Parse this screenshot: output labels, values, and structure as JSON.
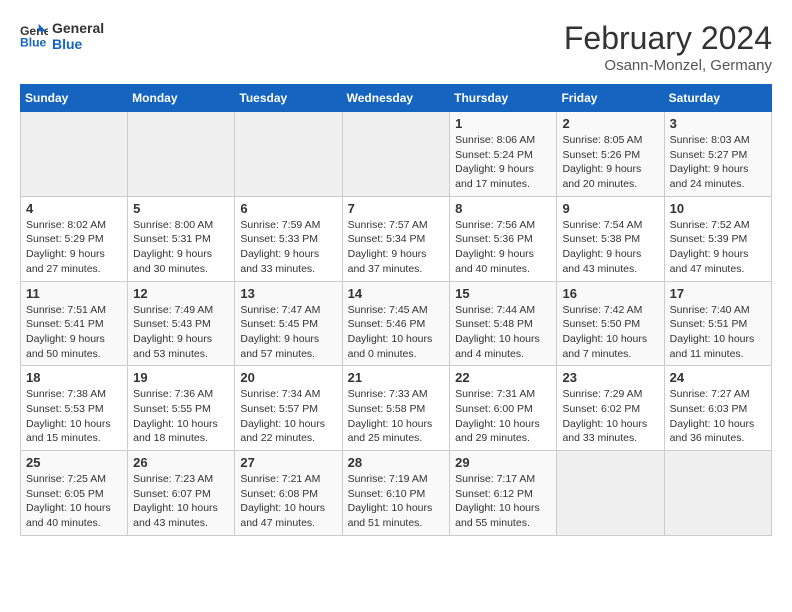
{
  "logo": {
    "text_general": "General",
    "text_blue": "Blue"
  },
  "header": {
    "month_year": "February 2024",
    "location": "Osann-Monzel, Germany"
  },
  "days_of_week": [
    "Sunday",
    "Monday",
    "Tuesday",
    "Wednesday",
    "Thursday",
    "Friday",
    "Saturday"
  ],
  "weeks": [
    [
      {
        "day": "",
        "info": ""
      },
      {
        "day": "",
        "info": ""
      },
      {
        "day": "",
        "info": ""
      },
      {
        "day": "",
        "info": ""
      },
      {
        "day": "1",
        "info": "Sunrise: 8:06 AM\nSunset: 5:24 PM\nDaylight: 9 hours\nand 17 minutes."
      },
      {
        "day": "2",
        "info": "Sunrise: 8:05 AM\nSunset: 5:26 PM\nDaylight: 9 hours\nand 20 minutes."
      },
      {
        "day": "3",
        "info": "Sunrise: 8:03 AM\nSunset: 5:27 PM\nDaylight: 9 hours\nand 24 minutes."
      }
    ],
    [
      {
        "day": "4",
        "info": "Sunrise: 8:02 AM\nSunset: 5:29 PM\nDaylight: 9 hours\nand 27 minutes."
      },
      {
        "day": "5",
        "info": "Sunrise: 8:00 AM\nSunset: 5:31 PM\nDaylight: 9 hours\nand 30 minutes."
      },
      {
        "day": "6",
        "info": "Sunrise: 7:59 AM\nSunset: 5:33 PM\nDaylight: 9 hours\nand 33 minutes."
      },
      {
        "day": "7",
        "info": "Sunrise: 7:57 AM\nSunset: 5:34 PM\nDaylight: 9 hours\nand 37 minutes."
      },
      {
        "day": "8",
        "info": "Sunrise: 7:56 AM\nSunset: 5:36 PM\nDaylight: 9 hours\nand 40 minutes."
      },
      {
        "day": "9",
        "info": "Sunrise: 7:54 AM\nSunset: 5:38 PM\nDaylight: 9 hours\nand 43 minutes."
      },
      {
        "day": "10",
        "info": "Sunrise: 7:52 AM\nSunset: 5:39 PM\nDaylight: 9 hours\nand 47 minutes."
      }
    ],
    [
      {
        "day": "11",
        "info": "Sunrise: 7:51 AM\nSunset: 5:41 PM\nDaylight: 9 hours\nand 50 minutes."
      },
      {
        "day": "12",
        "info": "Sunrise: 7:49 AM\nSunset: 5:43 PM\nDaylight: 9 hours\nand 53 minutes."
      },
      {
        "day": "13",
        "info": "Sunrise: 7:47 AM\nSunset: 5:45 PM\nDaylight: 9 hours\nand 57 minutes."
      },
      {
        "day": "14",
        "info": "Sunrise: 7:45 AM\nSunset: 5:46 PM\nDaylight: 10 hours\nand 0 minutes."
      },
      {
        "day": "15",
        "info": "Sunrise: 7:44 AM\nSunset: 5:48 PM\nDaylight: 10 hours\nand 4 minutes."
      },
      {
        "day": "16",
        "info": "Sunrise: 7:42 AM\nSunset: 5:50 PM\nDaylight: 10 hours\nand 7 minutes."
      },
      {
        "day": "17",
        "info": "Sunrise: 7:40 AM\nSunset: 5:51 PM\nDaylight: 10 hours\nand 11 minutes."
      }
    ],
    [
      {
        "day": "18",
        "info": "Sunrise: 7:38 AM\nSunset: 5:53 PM\nDaylight: 10 hours\nand 15 minutes."
      },
      {
        "day": "19",
        "info": "Sunrise: 7:36 AM\nSunset: 5:55 PM\nDaylight: 10 hours\nand 18 minutes."
      },
      {
        "day": "20",
        "info": "Sunrise: 7:34 AM\nSunset: 5:57 PM\nDaylight: 10 hours\nand 22 minutes."
      },
      {
        "day": "21",
        "info": "Sunrise: 7:33 AM\nSunset: 5:58 PM\nDaylight: 10 hours\nand 25 minutes."
      },
      {
        "day": "22",
        "info": "Sunrise: 7:31 AM\nSunset: 6:00 PM\nDaylight: 10 hours\nand 29 minutes."
      },
      {
        "day": "23",
        "info": "Sunrise: 7:29 AM\nSunset: 6:02 PM\nDaylight: 10 hours\nand 33 minutes."
      },
      {
        "day": "24",
        "info": "Sunrise: 7:27 AM\nSunset: 6:03 PM\nDaylight: 10 hours\nand 36 minutes."
      }
    ],
    [
      {
        "day": "25",
        "info": "Sunrise: 7:25 AM\nSunset: 6:05 PM\nDaylight: 10 hours\nand 40 minutes."
      },
      {
        "day": "26",
        "info": "Sunrise: 7:23 AM\nSunset: 6:07 PM\nDaylight: 10 hours\nand 43 minutes."
      },
      {
        "day": "27",
        "info": "Sunrise: 7:21 AM\nSunset: 6:08 PM\nDaylight: 10 hours\nand 47 minutes."
      },
      {
        "day": "28",
        "info": "Sunrise: 7:19 AM\nSunset: 6:10 PM\nDaylight: 10 hours\nand 51 minutes."
      },
      {
        "day": "29",
        "info": "Sunrise: 7:17 AM\nSunset: 6:12 PM\nDaylight: 10 hours\nand 55 minutes."
      },
      {
        "day": "",
        "info": ""
      },
      {
        "day": "",
        "info": ""
      }
    ]
  ]
}
